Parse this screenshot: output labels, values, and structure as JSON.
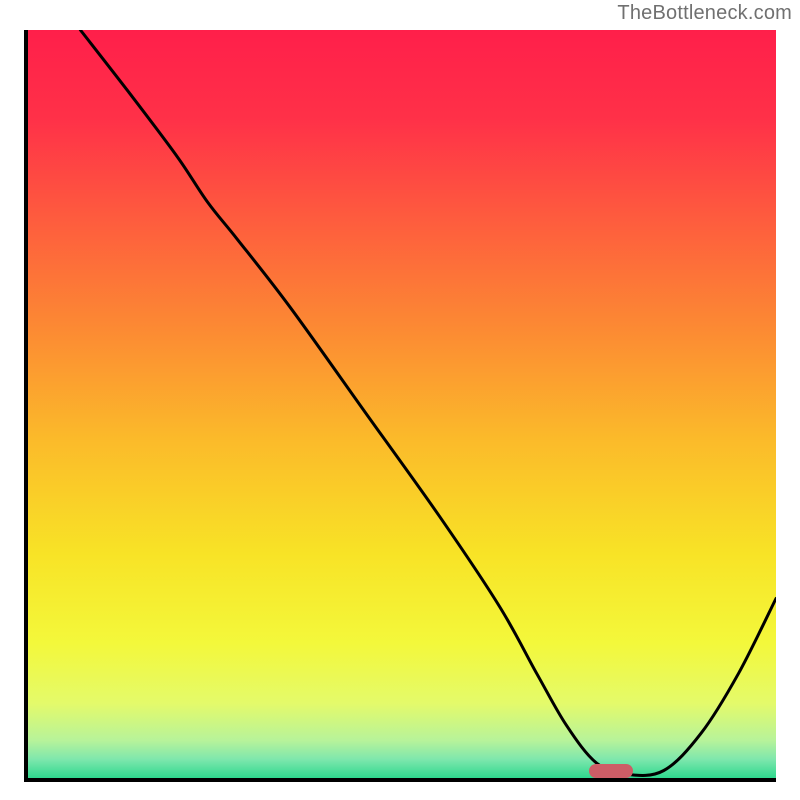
{
  "watermark": "TheBottleneck.com",
  "chart_data": {
    "type": "line",
    "title": "",
    "xlabel": "",
    "ylabel": "",
    "xlim": [
      0,
      100
    ],
    "ylim": [
      0,
      100
    ],
    "grid": false,
    "legend": false,
    "gradient_stops": [
      {
        "offset": 0.0,
        "color": "#ff1f4a"
      },
      {
        "offset": 0.12,
        "color": "#ff3148"
      },
      {
        "offset": 0.25,
        "color": "#fe5b3e"
      },
      {
        "offset": 0.4,
        "color": "#fc8a33"
      },
      {
        "offset": 0.55,
        "color": "#fbbb2a"
      },
      {
        "offset": 0.7,
        "color": "#f8e326"
      },
      {
        "offset": 0.82,
        "color": "#f3f83b"
      },
      {
        "offset": 0.9,
        "color": "#e4fa6a"
      },
      {
        "offset": 0.95,
        "color": "#b7f39a"
      },
      {
        "offset": 0.975,
        "color": "#7ee7ad"
      },
      {
        "offset": 1.0,
        "color": "#2fd88e"
      }
    ],
    "curve": {
      "x": [
        7,
        14,
        20,
        24,
        28,
        35,
        45,
        55,
        63,
        68,
        72,
        76,
        80,
        85,
        90,
        95,
        100
      ],
      "y": [
        100,
        91,
        83,
        77,
        72,
        63,
        49,
        35,
        23,
        14,
        7,
        2,
        0.5,
        1,
        6,
        14,
        24
      ]
    },
    "marker": {
      "x": 78,
      "y": 1,
      "color": "#cd5d66"
    }
  }
}
